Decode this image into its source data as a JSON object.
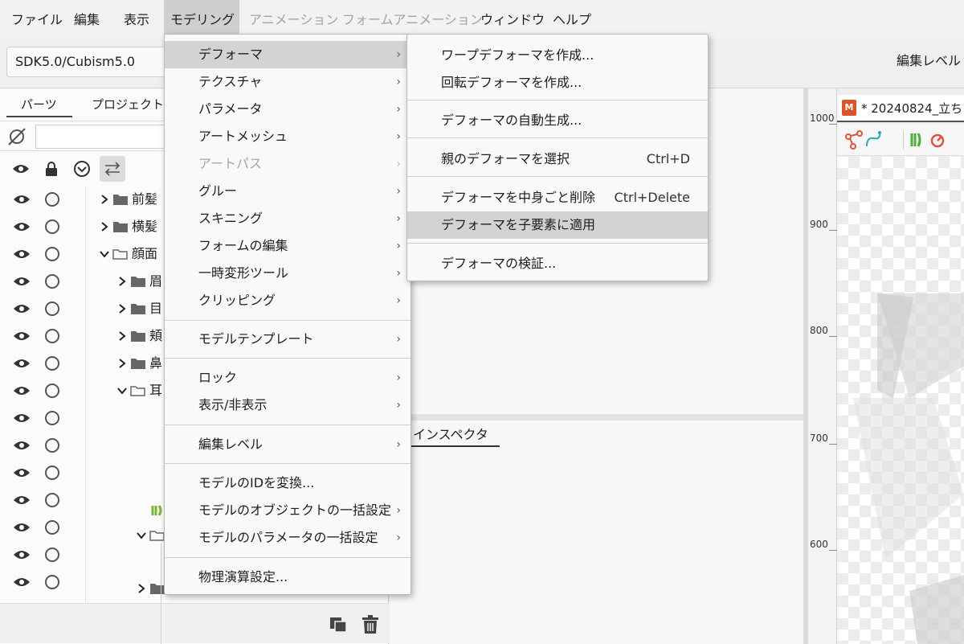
{
  "menubar": {
    "items": [
      {
        "label": "ファイル"
      },
      {
        "label": "編集"
      },
      {
        "label": "表示"
      },
      {
        "label": "モデリング"
      },
      {
        "label": "アニメーション"
      },
      {
        "label": "フォームアニメーション"
      },
      {
        "label": "ウィンドウ"
      },
      {
        "label": "ヘルプ"
      }
    ]
  },
  "toolbar": {
    "sdk_select_value": "SDK5.0/Cubism5.0",
    "edit_level_label": "編集レベル"
  },
  "left_panel": {
    "tabs": [
      {
        "label": "パーツ"
      },
      {
        "label": "プロジェクト"
      }
    ],
    "tree": [
      {
        "label": "前髪"
      },
      {
        "label": "横髪"
      },
      {
        "label": "顔面"
      },
      {
        "label": "眉"
      },
      {
        "label": "目"
      },
      {
        "label": "頬"
      },
      {
        "label": "鼻"
      },
      {
        "label": "耳"
      }
    ]
  },
  "modeling_menu": {
    "items": [
      {
        "label": "デフォーマ",
        "arrow": "›"
      },
      {
        "label": "テクスチャ",
        "arrow": "›"
      },
      {
        "label": "パラメータ",
        "arrow": "›"
      },
      {
        "label": "アートメッシュ",
        "arrow": "›"
      },
      {
        "label": "アートパス",
        "arrow": "›"
      },
      {
        "label": "グルー",
        "arrow": "›"
      },
      {
        "label": "スキニング",
        "arrow": "›"
      },
      {
        "label": "フォームの編集",
        "arrow": "›"
      },
      {
        "label": "一時変形ツール",
        "arrow": "›"
      },
      {
        "label": "クリッピング",
        "arrow": "›"
      },
      {
        "label": "モデルテンプレート",
        "arrow": "›"
      },
      {
        "label": "ロック",
        "arrow": "›"
      },
      {
        "label": "表示/非表示",
        "arrow": "›"
      },
      {
        "label": "編集レベル",
        "arrow": "›"
      },
      {
        "label": "モデルのIDを変換..."
      },
      {
        "label": "モデルのオブジェクトの一括設定",
        "arrow": "›"
      },
      {
        "label": "モデルのパラメータの一括設定",
        "arrow": "›"
      },
      {
        "label": "物理演算設定..."
      }
    ]
  },
  "deformer_submenu": {
    "items": [
      {
        "label": "ワープデフォーマを作成..."
      },
      {
        "label": "回転デフォーマを作成..."
      },
      {
        "label": "デフォーマの自動生成..."
      },
      {
        "label": "親のデフォーマを選択",
        "shortcut": "Ctrl+D"
      },
      {
        "label": "デフォーマを中身ごと削除",
        "shortcut": "Ctrl+Delete"
      },
      {
        "label": "デフォーマを子要素に適用"
      },
      {
        "label": "デフォーマの検証..."
      }
    ]
  },
  "inspector": {
    "tab_label": "インスペクタ"
  },
  "viewer": {
    "doc_icon": "M",
    "doc_title": "* 20240824_立ち",
    "ruler_ticks": [
      "1000",
      "900",
      "800",
      "700",
      "600"
    ]
  },
  "colors": {
    "menu_highlight": "#d3d3d3",
    "menubar_active": "#cfcfcf",
    "doc_icon": "#d9532b"
  },
  "icons": [
    "eye-icon",
    "lock-icon",
    "chevron-circle-icon",
    "swap-icon",
    "folder-icon",
    "duplicate-icon",
    "trash-icon",
    "filter-off-icon"
  ]
}
